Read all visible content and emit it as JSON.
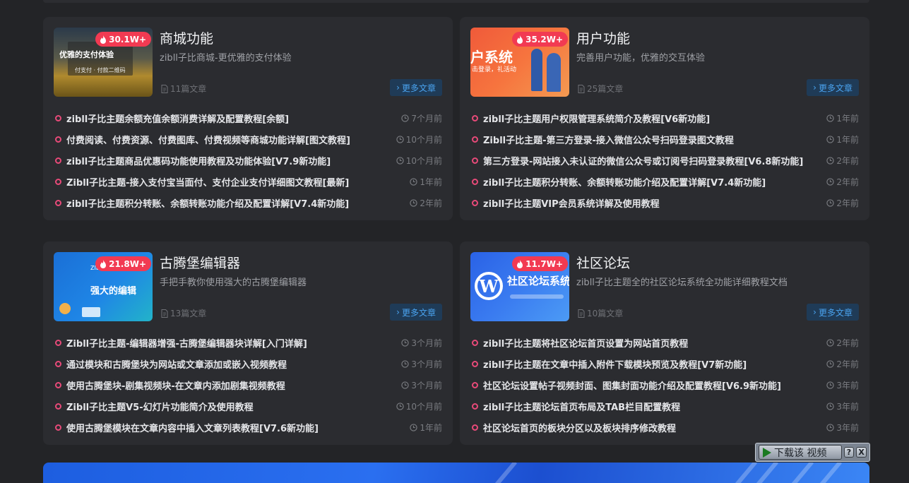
{
  "cards": [
    {
      "title": "商城功能",
      "desc": "zibll子比商城-更优雅的支付体验",
      "hot": "30.1W+",
      "count": "11篇文章",
      "more": "更多文章",
      "thumb_text": [
        "优雅的支付体验",
        "付支付 · 付款二维码"
      ],
      "items": [
        {
          "title": "zibll子比主题余额充值余额消费详解及配置教程[余额]",
          "time": "7个月前"
        },
        {
          "title": "付费阅读、付费资源、付费图库、付费视频等商城功能详解[图文教程]",
          "time": "10个月前"
        },
        {
          "title": "zibll子比主题商品优惠码功能使用教程及功能体验[V7.9新功能]",
          "time": "10个月前"
        },
        {
          "title": "Zibll子比主题-接入支付宝当面付、支付企业支付详细图文教程[最新]",
          "time": "1年前"
        },
        {
          "title": "zibll子比主题积分转账、余额转账功能介绍及配置详解[V7.4新功能]",
          "time": "2年前"
        }
      ]
    },
    {
      "title": "用户功能",
      "desc": "完善用户功能，优雅的交互体验",
      "hot": "35.2W+",
      "count": "25篇文章",
      "more": "更多文章",
      "thumb_text": [
        "户系统",
        "击登录，礼活动"
      ],
      "items": [
        {
          "title": "zibll子比主题用户权限管理系统简介及教程[V6新功能]",
          "time": "1年前"
        },
        {
          "title": "Zibll子比主题-第三方登录-接入微信公众号扫码登录图文教程",
          "time": "1年前"
        },
        {
          "title": "第三方登录-网站接入未认证的微信公众号或订阅号扫码登录教程[V6.8新功能]",
          "time": "2年前"
        },
        {
          "title": "zibll子比主题积分转账、余额转账功能介绍及配置详解[V7.4新功能]",
          "time": "2年前"
        },
        {
          "title": "zibll子比主题VIP会员系统详解及使用教程",
          "time": "2年前"
        }
      ]
    },
    {
      "title": "古腾堡编辑器",
      "desc": "手把手教你使用强大的古腾堡编辑器",
      "hot": "21.8W+",
      "count": "13篇文章",
      "more": "更多文章",
      "thumb_text": [
        "强大的编辑",
        "ZIB & Gutenber"
      ],
      "items": [
        {
          "title": "Zibll子比主题-编辑器增强-古腾堡编辑器块详解[入门详解]",
          "time": "3个月前"
        },
        {
          "title": "通过模块和古腾堡块为网站或文章添加或嵌入视频教程",
          "time": "3个月前"
        },
        {
          "title": "使用古腾堡块-剧集视频块-在文章内添加剧集视频教程",
          "time": "3个月前"
        },
        {
          "title": "Zibll子比主题V5-幻灯片功能简介及使用教程",
          "time": "10个月前"
        },
        {
          "title": "使用古腾堡模块在文章内容中插入文章列表教程[V7.6新功能]",
          "time": "1年前"
        }
      ]
    },
    {
      "title": "社区论坛",
      "desc": "zibll子比主题全的社区论坛系统全功能详细教程文档",
      "hot": "11.7W+",
      "count": "10篇文章",
      "more": "更多文章",
      "thumb_text": [
        "社区论坛系统"
      ],
      "items": [
        {
          "title": "zibll子比主题将社区论坛首页设置为网站首页教程",
          "time": "2年前"
        },
        {
          "title": "zibll子比主题在文章中插入附件下载模块预览及教程[V7新功能]",
          "time": "2年前"
        },
        {
          "title": "社区论坛设置帖子视频封面、图集封面功能介绍及配置教程[V6.9新功能]",
          "time": "3年前"
        },
        {
          "title": "zibll子比主题论坛首页布局及TAB栏目配置教程",
          "time": "3年前"
        },
        {
          "title": "社区论坛首页的板块分区以及板块排序修改教程",
          "time": "3年前"
        }
      ]
    }
  ],
  "download_widget": {
    "label": "下载该 视频",
    "help": "?",
    "close": "X"
  },
  "colors": {
    "background": "#232427",
    "card": "#2b2c30",
    "hot_badge": "#f23a52",
    "more_button_bg": "#1f3b57",
    "more_button_text": "#4aa3ef",
    "list_dot": "#e84a79"
  }
}
